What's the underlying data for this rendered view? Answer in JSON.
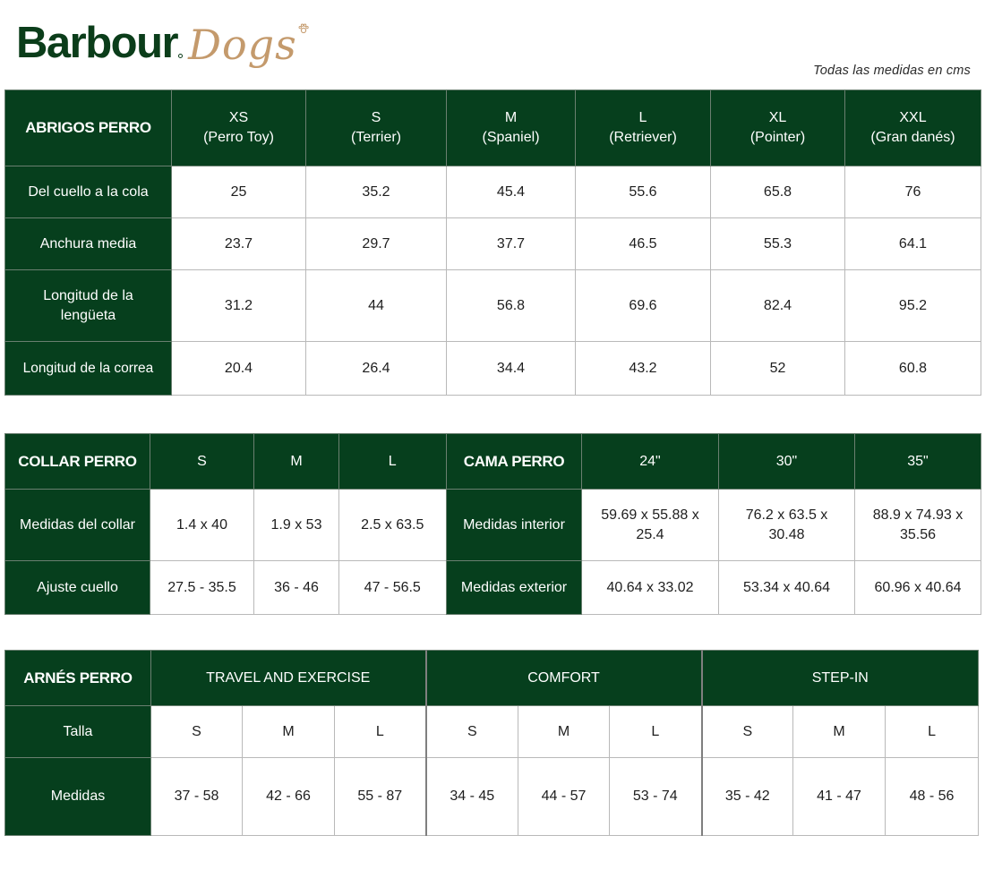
{
  "brand": {
    "name": "Barbour",
    "sub": "Dogs",
    "name_color": "#0b3d1a",
    "sub_color": "#c49a6c"
  },
  "units_note": "Todas las medidas en cms",
  "accent_color": "#063f1d",
  "coats": {
    "title": "ABRIGOS PERRO",
    "sizes": [
      {
        "size": "XS",
        "breed": "(Perro Toy)"
      },
      {
        "size": "S",
        "breed": "(Terrier)"
      },
      {
        "size": "M",
        "breed": "(Spaniel)"
      },
      {
        "size": "L",
        "breed": "(Retriever)"
      },
      {
        "size": "XL",
        "breed": "(Pointer)"
      },
      {
        "size": "XXL",
        "breed": "(Gran danés)"
      }
    ],
    "rows": [
      {
        "label": "Del cuello a la cola",
        "values": [
          "25",
          "35.2",
          "45.4",
          "55.6",
          "65.8",
          "76"
        ]
      },
      {
        "label": "Anchura media",
        "values": [
          "23.7",
          "29.7",
          "37.7",
          "46.5",
          "55.3",
          "64.1"
        ]
      },
      {
        "label": "Longitud de la lengüeta",
        "values": [
          "31.2",
          "44",
          "56.8",
          "69.6",
          "82.4",
          "95.2"
        ]
      },
      {
        "label": "Longitud de la correa",
        "values": [
          "20.4",
          "26.4",
          "34.4",
          "43.2",
          "52",
          "60.8"
        ]
      }
    ]
  },
  "collar": {
    "title": "COLLAR PERRO",
    "sizes": [
      "S",
      "M",
      "L"
    ],
    "rows": [
      {
        "label": "Medidas del collar",
        "values": [
          "1.4 x 40",
          "1.9 x 53",
          "2.5 x 63.5"
        ]
      },
      {
        "label": "Ajuste cuello",
        "values": [
          "27.5 - 35.5",
          "36 - 46",
          "47 - 56.5"
        ]
      }
    ]
  },
  "bed": {
    "title": "CAMA PERRO",
    "sizes": [
      "24\"",
      "30\"",
      "35\""
    ],
    "rows": [
      {
        "label": "Medidas interior",
        "values": [
          "59.69 x 55.88 x 25.4",
          "76.2 x 63.5 x 30.48",
          "88.9 x 74.93 x 35.56"
        ]
      },
      {
        "label": "Medidas exterior",
        "values": [
          "40.64 x 33.02",
          "53.34 x 40.64",
          "60.96 x 40.64"
        ]
      }
    ]
  },
  "harness": {
    "title": "ARNÉS PERRO",
    "groups": [
      {
        "name": "TRAVEL AND EXERCISE",
        "sizes": [
          "S",
          "M",
          "L"
        ],
        "values": [
          "37 - 58",
          "42 - 66",
          "55 - 87"
        ]
      },
      {
        "name": "COMFORT",
        "sizes": [
          "S",
          "M",
          "L"
        ],
        "values": [
          "34 - 45",
          "44 - 57",
          "53 - 74"
        ]
      },
      {
        "name": "STEP-IN",
        "sizes": [
          "S",
          "M",
          "L"
        ],
        "values": [
          "35 - 42",
          "41 - 47",
          "48 - 56"
        ]
      }
    ],
    "size_label": "Talla",
    "measure_label": "Medidas"
  }
}
